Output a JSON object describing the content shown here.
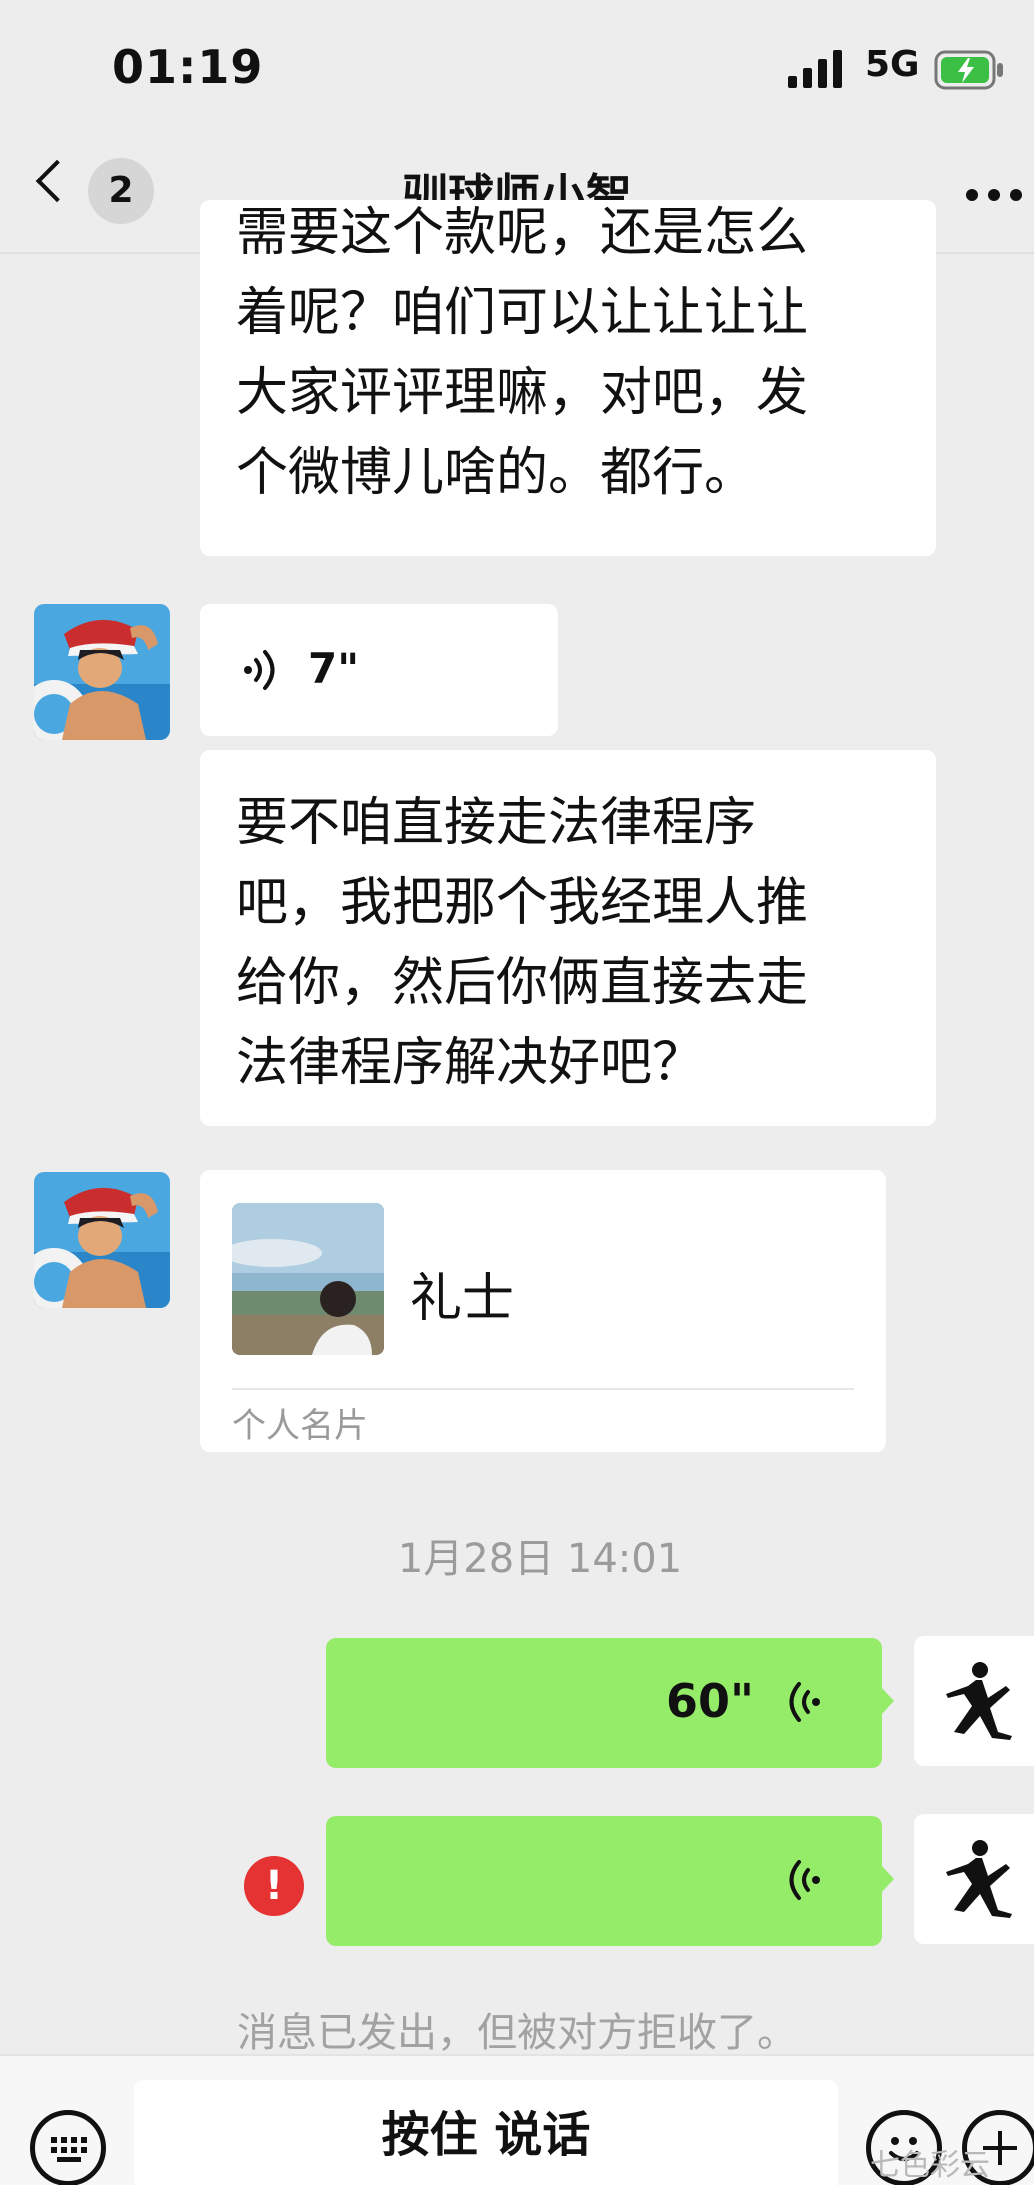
{
  "status_bar": {
    "time": "01:19",
    "network": "5G",
    "battery_charging": true
  },
  "nav": {
    "back_count": "2",
    "title": "驯球师小智"
  },
  "messages": {
    "first_lines": [
      "需要这个款呢，还是怎么",
      "着呢？咱们可以让让让让",
      "大家评评理嘛，对吧，发",
      "个微博儿啥的。都行。"
    ],
    "voice_in": {
      "duration": "7\""
    },
    "second_lines": [
      "要不咱直接走法律程序",
      "吧，我把那个我经理人推",
      "给你，然后你俩直接去走",
      "法律程序解决好吧？"
    ],
    "card": {
      "name": "礼士",
      "type": "个人名片"
    },
    "timestamp": "1月28日 14:01",
    "voice_out": {
      "duration": "60\""
    },
    "voice_failed": {
      "error_mark": "!"
    },
    "notice": "消息已发出，但被对方拒收了。"
  },
  "input": {
    "talk_label": "按住 说话"
  },
  "watermark": "七色彩云",
  "colors": {
    "bubble_green": "#95ec69",
    "error_red": "#e53232",
    "bg": "#ededed"
  }
}
